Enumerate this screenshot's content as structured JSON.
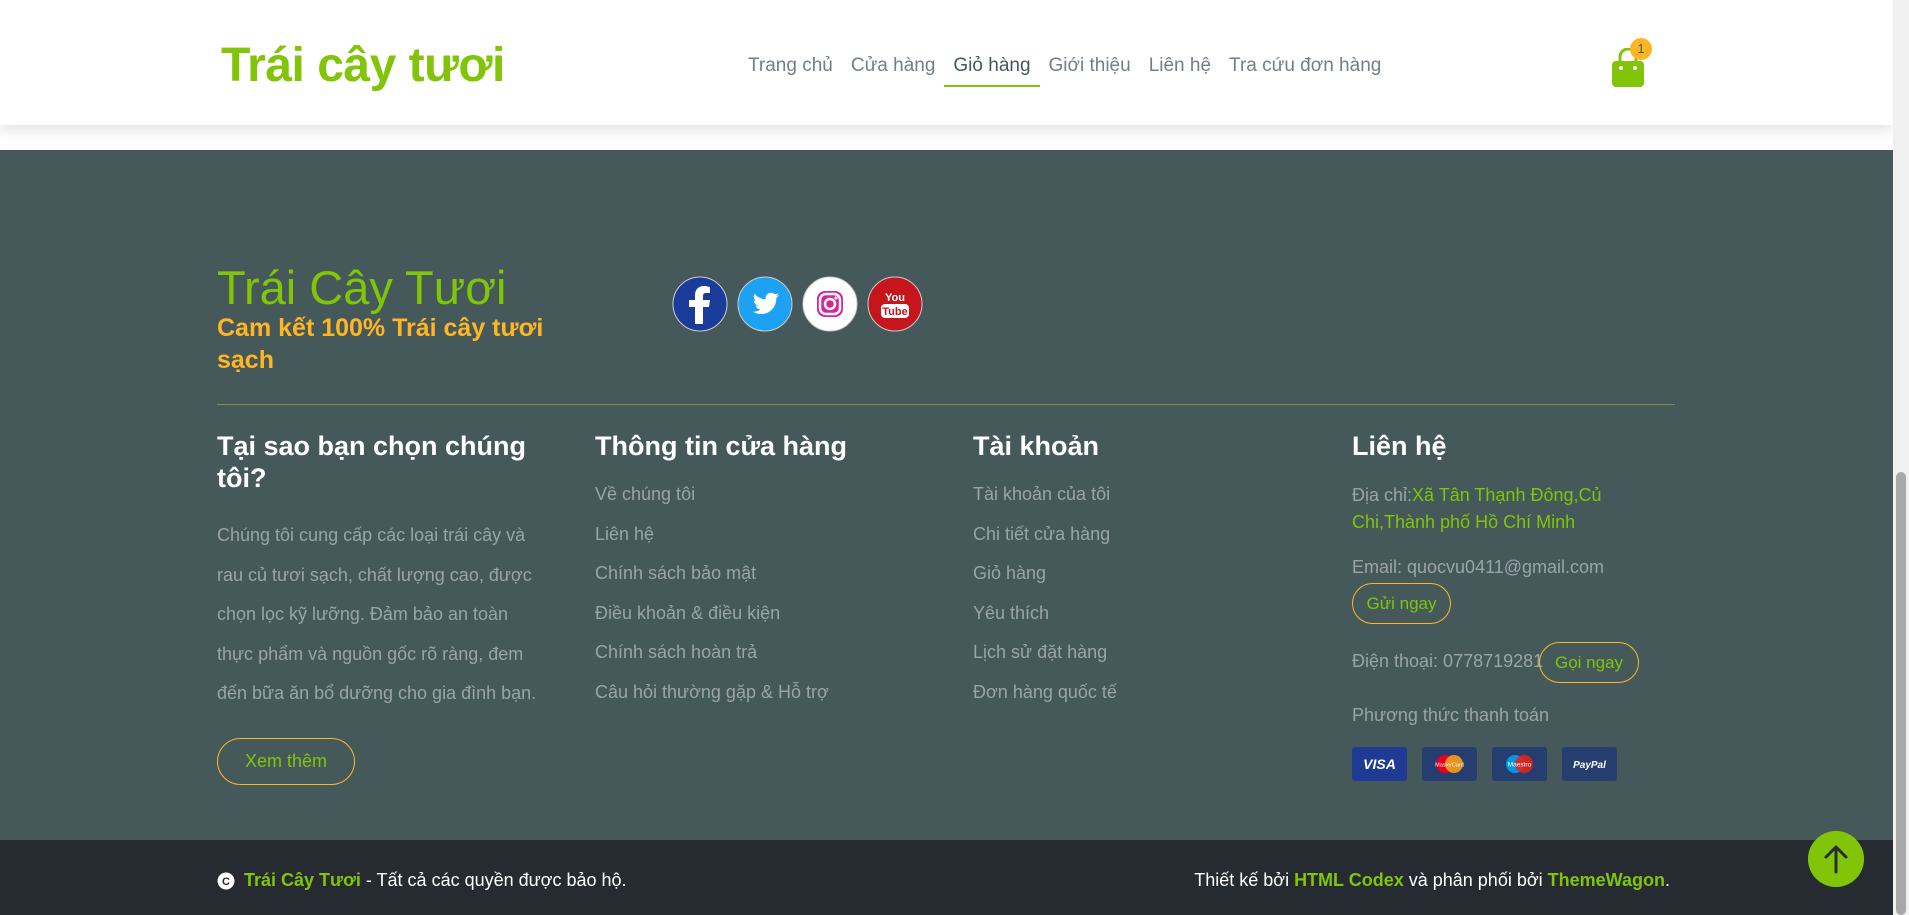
{
  "header": {
    "brand": "Trái cây tươi",
    "nav": [
      "Trang chủ",
      "Cửa hàng",
      "Giỏ hàng",
      "Giới thiệu",
      "Liên hệ",
      "Tra cứu đơn hàng"
    ],
    "active_nav": "Giỏ hàng",
    "cart_count": "1",
    "cart_icon": "shopping-bag-icon"
  },
  "footer": {
    "brand": "Trái Cây Tươi",
    "tagline": "Cam kết 100% Trái cây tươi sạch",
    "socials": [
      "facebook-icon",
      "twitter-icon",
      "instagram-icon",
      "youtube-icon"
    ],
    "why": {
      "title": "Tại sao bạn chọn chúng tôi?",
      "text": "Chúng tôi cung cấp các loại trái cây và rau củ tươi sạch, chất lượng cao, được chọn lọc kỹ lưỡng. Đảm bảo an toàn thực phẩm và nguồn gốc rõ ràng, đem đến bữa ăn bổ dưỡng cho gia đình bạn.",
      "button": "Xem thêm"
    },
    "store_info": {
      "title": "Thông tin cửa hàng",
      "links": [
        "Về chúng tôi",
        "Liên hệ",
        "Chính sách bảo mật",
        "Điều khoản & điều kiện",
        "Chính sách hoàn trả",
        "Câu hỏi thường gặp & Hỗ trợ"
      ]
    },
    "account": {
      "title": "Tài khoản",
      "links": [
        "Tài khoản của tôi",
        "Chi tiết cửa hàng",
        "Giỏ hàng",
        "Yêu thích",
        "Lịch sử đặt hàng",
        "Đơn hàng quốc tế"
      ]
    },
    "contact": {
      "title": "Liên hệ",
      "address_label": "Địa chỉ:",
      "address_value": "Xã Tân Thạnh Đông,Củ Chi,Thành phố Hồ Chí Minh",
      "email": "Email: quocvu0411@gmail.com",
      "email_button": "Gửi ngay",
      "phone": "Điện thoại: 0778719281",
      "phone_button": "Gọi ngay",
      "payment_label": "Phương thức thanh toán",
      "payments": [
        "VISA",
        "MasterCard",
        "Maestro",
        "PayPal"
      ]
    }
  },
  "copyright": {
    "brand": "Trái Cây Tươi",
    "rights": " - Tất cả các quyền được bảo hộ.",
    "designed_by": "Thiết kế bởi ",
    "designer": "HTML Codex",
    "distributed_by": " và phân phối bởi ",
    "distributor": "ThemeWagon",
    "end": "."
  },
  "colors": {
    "primary": "#81c408",
    "secondary": "#ffb524",
    "footer_bg": "#45595b",
    "copyright_bg": "#262b31"
  }
}
